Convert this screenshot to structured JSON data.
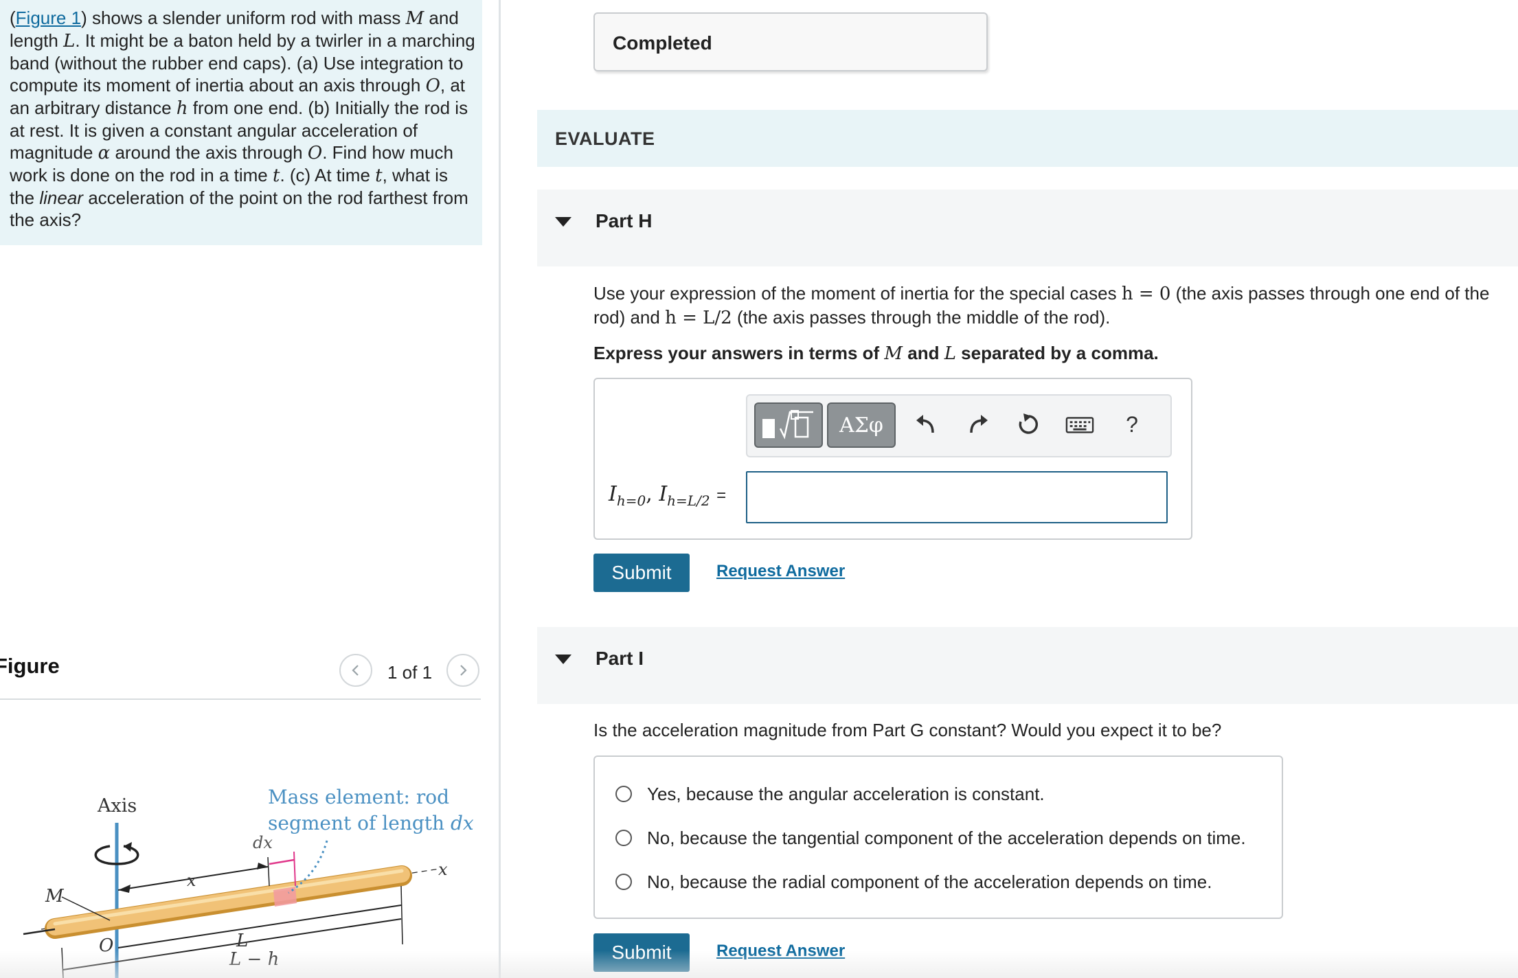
{
  "problem": {
    "figure_link": "Figure 1",
    "seg1": ") shows a slender uniform rod with mass ",
    "var_M": "M",
    "seg2": " and length ",
    "var_L": "L",
    "seg3": ". It might be a baton held by a twirler in a marching band (without the rubber end caps). (a) Use integration to compute its moment of inertia about an axis through ",
    "var_O": "O",
    "seg4": ", at an arbitrary distance ",
    "var_h": "h",
    "seg5": " from one end. (b) Initially the rod is at rest. It is given a constant angular acceleration of magnitude ",
    "var_alpha": "α",
    "seg6": " around the axis through ",
    "var_O2": "O",
    "seg7": ". Find how much work is done on the rod in a time ",
    "var_t": "t",
    "seg8": ". (c) At time ",
    "var_t2": "t",
    "seg9": ", what is the ",
    "linear": "linear",
    "seg10": " acceleration of the point on the rod farthest from the axis?"
  },
  "figure_panel": {
    "title": "Figure",
    "pager": "1 of 1",
    "diagram": {
      "axis_label": "Axis",
      "mass_element_line1": "Mass element: rod",
      "mass_element_line2_prefix": "segment of length ",
      "mass_element_dx": "dx",
      "dx_label": "dx",
      "x_label": "x",
      "x_axis_label": "x",
      "M_label": "M",
      "O_label": "O",
      "L_label": "L",
      "L_minus_h_label": "L − h"
    }
  },
  "completed": {
    "label": "Completed"
  },
  "evaluate": {
    "label": "EVALUATE"
  },
  "partH": {
    "title": "Part H",
    "instr_a": "Use your expression of the moment of inertia for the special cases ",
    "eq_h0": "h = 0",
    "instr_b": " (the axis passes through one end of the rod) and ",
    "eq_hL2": "h = L/2",
    "instr_c": " (the axis passes through the middle of the rod).",
    "express_a": "Express your answers in terms of ",
    "express_M": "M",
    "express_and": " and ",
    "express_L": "L",
    "express_b": " separated by a comma.",
    "toolbar": {
      "templates_icon": "templates-icon",
      "greek": "ΑΣφ",
      "undo_icon": "undo-icon",
      "redo_icon": "redo-icon",
      "reset_icon": "reset-icon",
      "keyboard_icon": "keyboard-icon",
      "help": "?"
    },
    "label_I1": "I",
    "label_sub1": "h=0",
    "label_comma": ", ",
    "label_I2": "I",
    "label_sub2": "h=L/2",
    "label_eq": "=",
    "input_value": "",
    "submit": "Submit",
    "request": "Request Answer"
  },
  "partI": {
    "title": "Part I",
    "question": "Is the acceleration magnitude from Part G constant? Would you expect it to be?",
    "options": [
      "Yes, because the angular acceleration is constant.",
      "No, because the tangential component of the acceleration depends on time.",
      "No, because the radial component of the acceleration depends on time."
    ],
    "submit": "Submit",
    "request": "Request Answer"
  },
  "colors": {
    "accent": "#1c6b92",
    "link": "#0e6a9e",
    "panel_bg": "#e8f4f7",
    "diagram_blue": "#4a90c2",
    "rod": "#f1c277"
  }
}
